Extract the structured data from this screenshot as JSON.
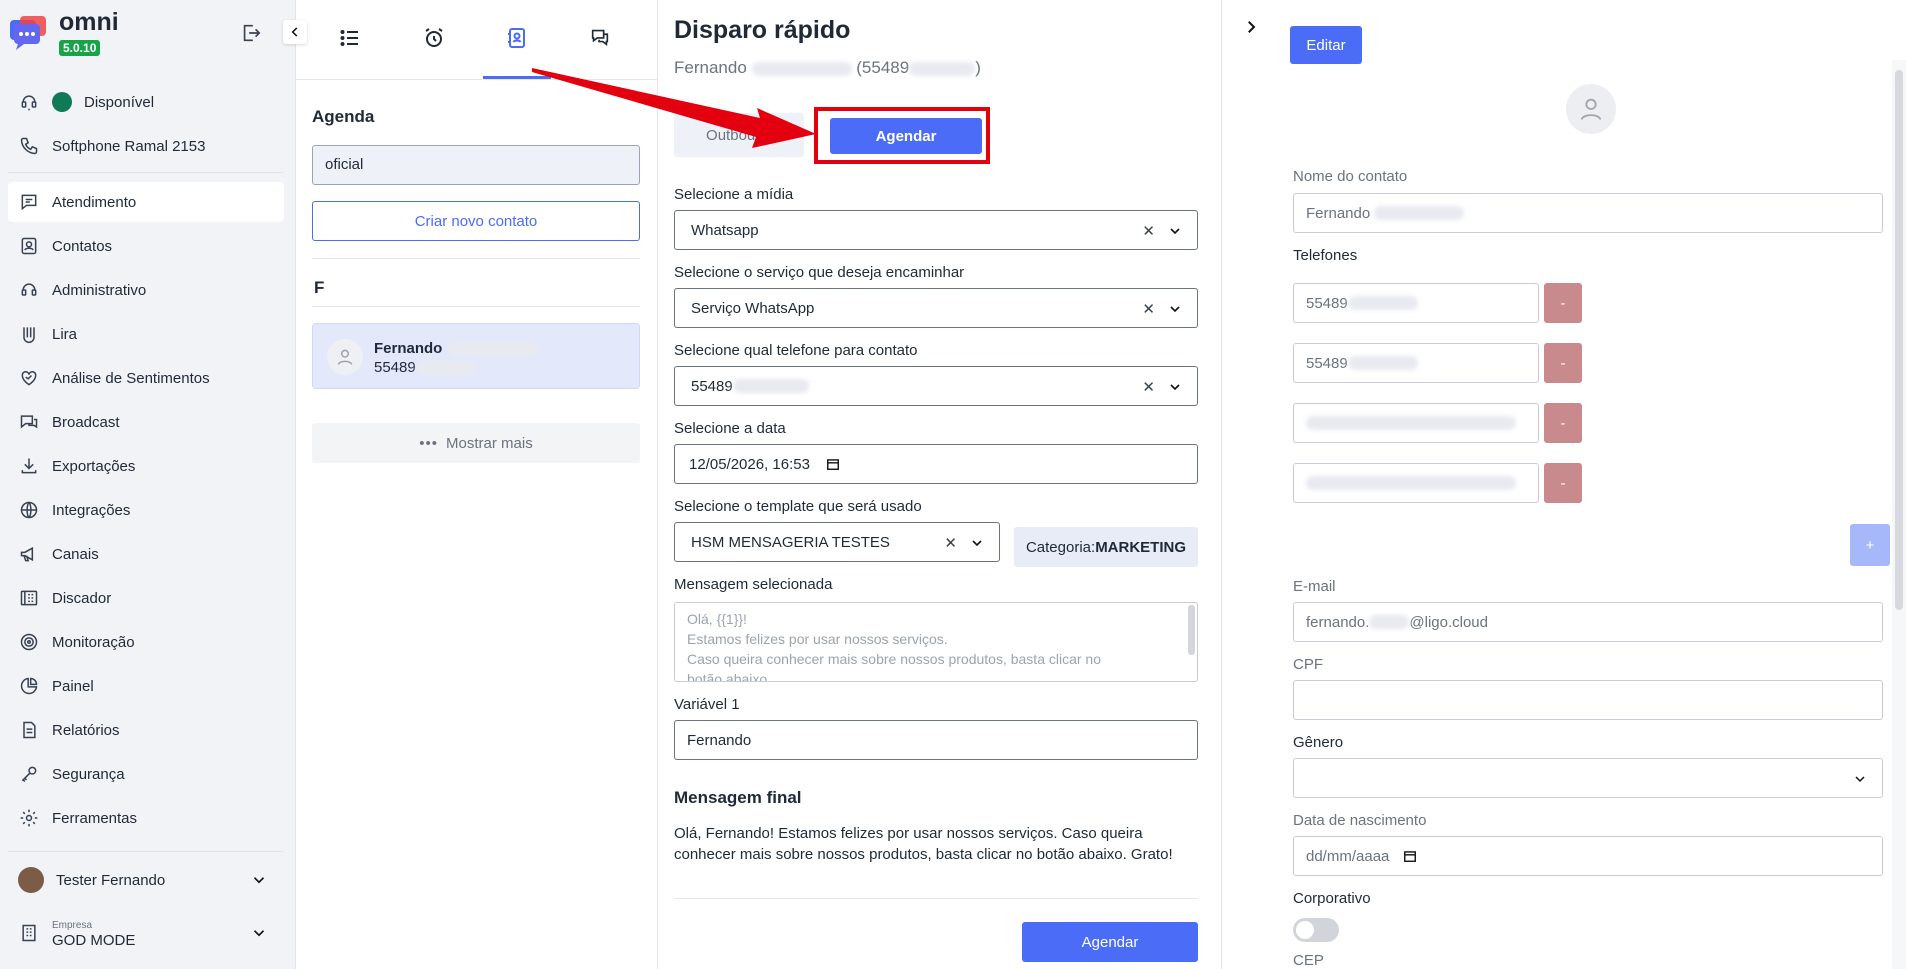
{
  "app": {
    "name": "omni",
    "version": "5.0.10"
  },
  "sidebar": {
    "status": "Disponível",
    "softphone": "Softphone Ramal 2153",
    "items": [
      {
        "label": "Atendimento",
        "icon": "chat-icon"
      },
      {
        "label": "Contatos",
        "icon": "contacts-icon"
      },
      {
        "label": "Administrativo",
        "icon": "admin-icon"
      },
      {
        "label": "Lira",
        "icon": "lira-icon"
      },
      {
        "label": "Análise de Sentimentos",
        "icon": "sentiment-icon"
      },
      {
        "label": "Broadcast",
        "icon": "broadcast-icon"
      },
      {
        "label": "Exportações",
        "icon": "download-icon"
      },
      {
        "label": "Integrações",
        "icon": "globe-icon"
      },
      {
        "label": "Canais",
        "icon": "megaphone-icon"
      },
      {
        "label": "Discador",
        "icon": "dialer-icon"
      },
      {
        "label": "Monitoração",
        "icon": "monitor-icon"
      },
      {
        "label": "Painel",
        "icon": "pie-chart-icon"
      },
      {
        "label": "Relatórios",
        "icon": "report-icon"
      },
      {
        "label": "Segurança",
        "icon": "key-icon"
      },
      {
        "label": "Ferramentas",
        "icon": "gear-icon"
      }
    ],
    "user": "Tester Fernando",
    "company_label": "Empresa",
    "company": "GOD MODE"
  },
  "agenda": {
    "title": "Agenda",
    "search_value": "oficial",
    "new_contact": "Criar novo contato",
    "letter": "F",
    "contact": {
      "name": "Fernando",
      "phone": "55489"
    },
    "show_more": "Mostrar mais"
  },
  "disparo": {
    "title": "Disparo rápido",
    "subtitle_name": "Fernando",
    "subtitle_phone_open": "(55489",
    "subtitle_phone_close": ")",
    "tab_outbound": "Outbound",
    "tab_agendar": "Agendar",
    "label_midia": "Selecione a mídia",
    "midia": "Whatsapp",
    "label_servico": "Selecione o serviço que deseja encaminhar",
    "servico": "Serviço WhatsApp",
    "label_telefone": "Selecione qual telefone para contato",
    "telefone": "55489",
    "label_data": "Selecione a data",
    "data": "12/05/2026, 16:53",
    "label_template": "Selecione o template que será usado",
    "template": "HSM MENSAGERIA TESTES",
    "categoria_label": "Categoria:",
    "categoria_value": "MARKETING",
    "label_mensagem": "Mensagem selecionada",
    "mensagem_lines": [
      "Olá, {{1}}!",
      "Estamos felizes por usar nossos serviços.",
      "Caso queira conhecer mais sobre nossos produtos, basta clicar no",
      "botão abaixo."
    ],
    "label_variavel": "Variável 1",
    "variavel": "Fernando",
    "final_title": "Mensagem final",
    "final_text": "Olá, Fernando! Estamos felizes por usar nossos serviços. Caso queira conhecer mais sobre nossos produtos, basta clicar no botão abaixo. Grato!",
    "submit": "Agendar"
  },
  "contact_panel": {
    "edit": "Editar",
    "label_nome": "Nome do contato",
    "nome": "Fernando",
    "label_telefones": "Telefones",
    "phones": [
      "55489",
      "55489",
      "",
      ""
    ],
    "minus": "-",
    "plus": "+",
    "label_email": "E-mail",
    "email_prefix": "fernando.",
    "email_suffix": "@ligo.cloud",
    "label_cpf": "CPF",
    "label_genero": "Gênero",
    "label_nascimento": "Data de nascimento",
    "nascimento_placeholder": "dd/mm/aaaa",
    "label_corporativo": "Corporativo",
    "label_cep": "CEP"
  },
  "colors": {
    "primary": "#4a6cf7",
    "highlight": "#e3000f",
    "danger_muted": "#c98a8e",
    "status_online": "#0f7a55"
  }
}
